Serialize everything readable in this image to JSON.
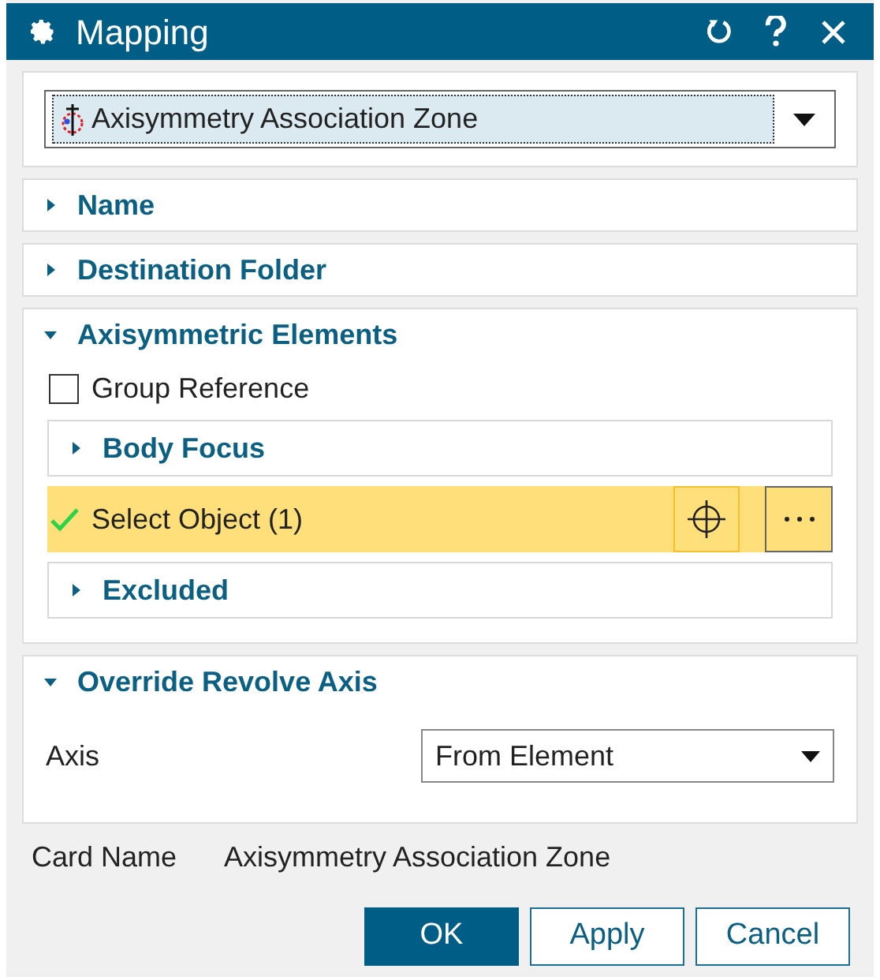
{
  "window": {
    "title": "Mapping"
  },
  "type_selector": {
    "value": "Axisymmetry Association Zone"
  },
  "sections": [
    {
      "title": "Name",
      "expanded": false
    },
    {
      "title": "Destination Folder",
      "expanded": false
    },
    {
      "title": "Axisymmetric Elements",
      "expanded": true,
      "items": [
        {
          "kind": "checkbox",
          "label": "Group Reference",
          "checked": false
        },
        {
          "kind": "subsection",
          "title": "Body Focus",
          "expanded": false
        },
        {
          "kind": "selection",
          "label": "Select Object (1)",
          "done": true
        },
        {
          "kind": "subsection",
          "title": "Excluded",
          "expanded": false
        }
      ]
    },
    {
      "title": "Override Revolve Axis",
      "expanded": true,
      "items": [
        {
          "kind": "dropdown",
          "label": "Axis",
          "value": "From Element"
        }
      ]
    }
  ],
  "card_name": {
    "label": "Card Name",
    "value": "Axisymmetry Association Zone"
  },
  "buttons": [
    {
      "label": "OK",
      "primary": true
    },
    {
      "label": "Apply",
      "primary": false
    },
    {
      "label": "Cancel",
      "primary": false
    }
  ]
}
